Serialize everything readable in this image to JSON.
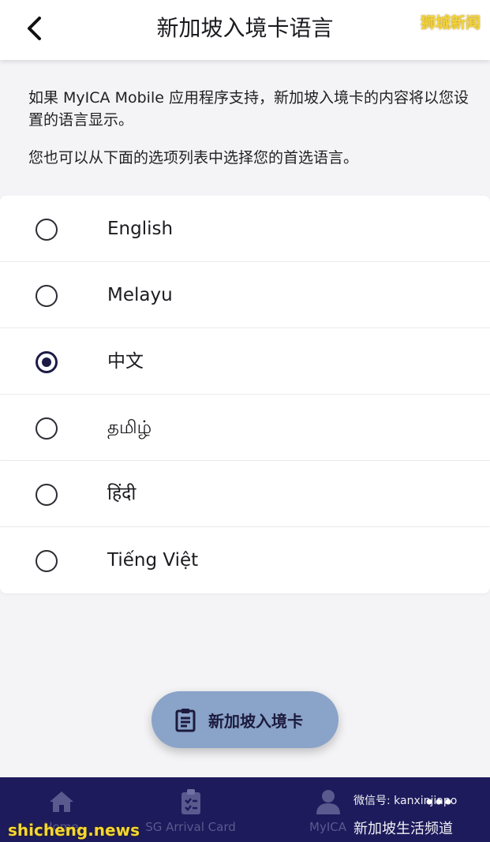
{
  "header": {
    "title": "新加坡入境卡语言",
    "back_icon": "chevron-left-icon"
  },
  "intro": {
    "line1": "如果 MyICA Mobile 应用程序支持，新加坡入境卡的内容将以您设置的语言显示。",
    "line2": "您也可以从下面的选项列表中选择您的首选语言。"
  },
  "languages": [
    {
      "label": "English",
      "selected": false
    },
    {
      "label": "Melayu",
      "selected": false
    },
    {
      "label": "中文",
      "selected": true
    },
    {
      "label": "தமிழ்",
      "selected": false
    },
    {
      "label": "हिंदी",
      "selected": false
    },
    {
      "label": "Tiếng Việt",
      "selected": false
    }
  ],
  "fab": {
    "label": "新加坡入境卡",
    "icon": "clipboard-icon"
  },
  "bottom_nav": [
    {
      "label": "Home",
      "icon": "home-icon"
    },
    {
      "label": "SG Arrival Card",
      "icon": "clipboard-check-icon"
    },
    {
      "label": "MyICA",
      "icon": "person-icon"
    },
    {
      "label": "",
      "icon": "more-icon"
    }
  ],
  "watermarks": {
    "top_right": "狮城新闻",
    "bottom_left": "shicheng.news",
    "bottom_right_1": "微信号: kanxinjiapo",
    "bottom_right_2": "新加坡生活频道"
  },
  "colors": {
    "nav_bg": "#1d1b5c",
    "fab_bg": "#8aa3c8",
    "accent": "#1d1b46"
  }
}
